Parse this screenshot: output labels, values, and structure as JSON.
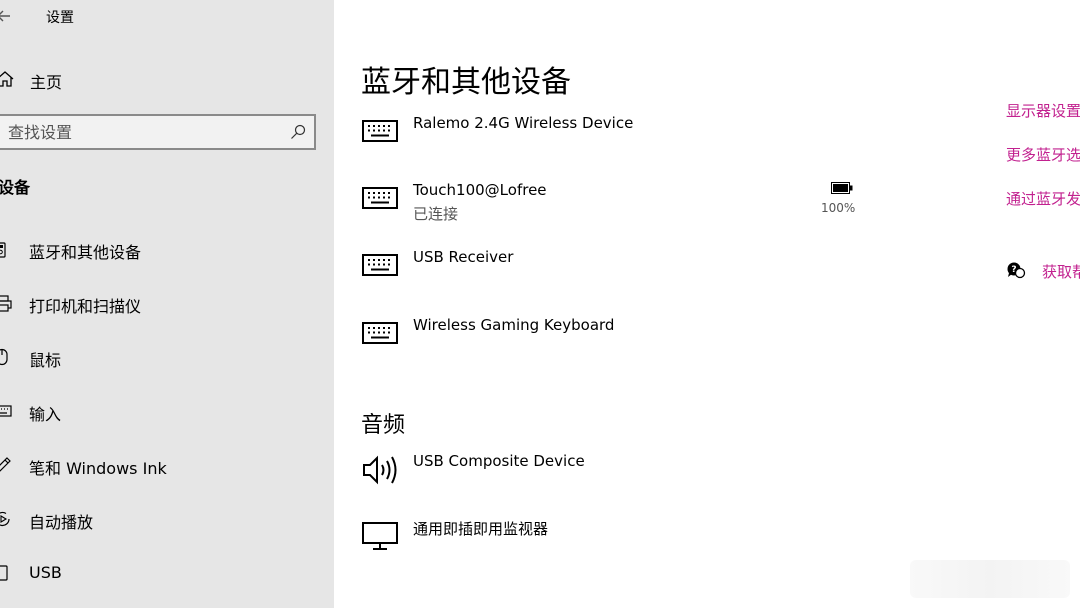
{
  "window": {
    "title": "设置"
  },
  "sidebar": {
    "home_label": "主页",
    "search_placeholder": "查找设置",
    "section_title": "设备",
    "items": [
      {
        "label": "蓝牙和其他设备",
        "icon": "bluetooth-devices-icon"
      },
      {
        "label": "打印机和扫描仪",
        "icon": "printer-icon"
      },
      {
        "label": "鼠标",
        "icon": "mouse-icon"
      },
      {
        "label": "输入",
        "icon": "keyboard-icon"
      },
      {
        "label": "笔和 Windows Ink",
        "icon": "pen-icon"
      },
      {
        "label": "自动播放",
        "icon": "autoplay-icon"
      },
      {
        "label": "USB",
        "icon": "usb-icon"
      }
    ]
  },
  "main": {
    "title": "蓝牙和其他设备",
    "devices": [
      {
        "name": "Ralemo 2.4G Wireless Device",
        "status": "",
        "icon": "keyboard-icon"
      },
      {
        "name": "Touch100@Lofree",
        "status": "已连接",
        "icon": "keyboard-icon",
        "battery": "100%"
      },
      {
        "name": "USB Receiver",
        "status": "",
        "icon": "keyboard-icon"
      },
      {
        "name": "Wireless Gaming Keyboard",
        "status": "",
        "icon": "keyboard-icon"
      }
    ],
    "audio_title": "音频",
    "audio_devices": [
      {
        "name": "USB Composite Device",
        "icon": "speaker-icon"
      },
      {
        "name": "通用即插即用监视器",
        "icon": "monitor-icon"
      }
    ]
  },
  "related": {
    "links": [
      "显示器设置",
      "更多蓝牙选项",
      "通过蓝牙发"
    ],
    "help_label": "获取帮"
  },
  "colors": {
    "accent": "#c2218f",
    "sidebar_bg": "#e6e6e6",
    "main_bg": "#ffffff"
  }
}
